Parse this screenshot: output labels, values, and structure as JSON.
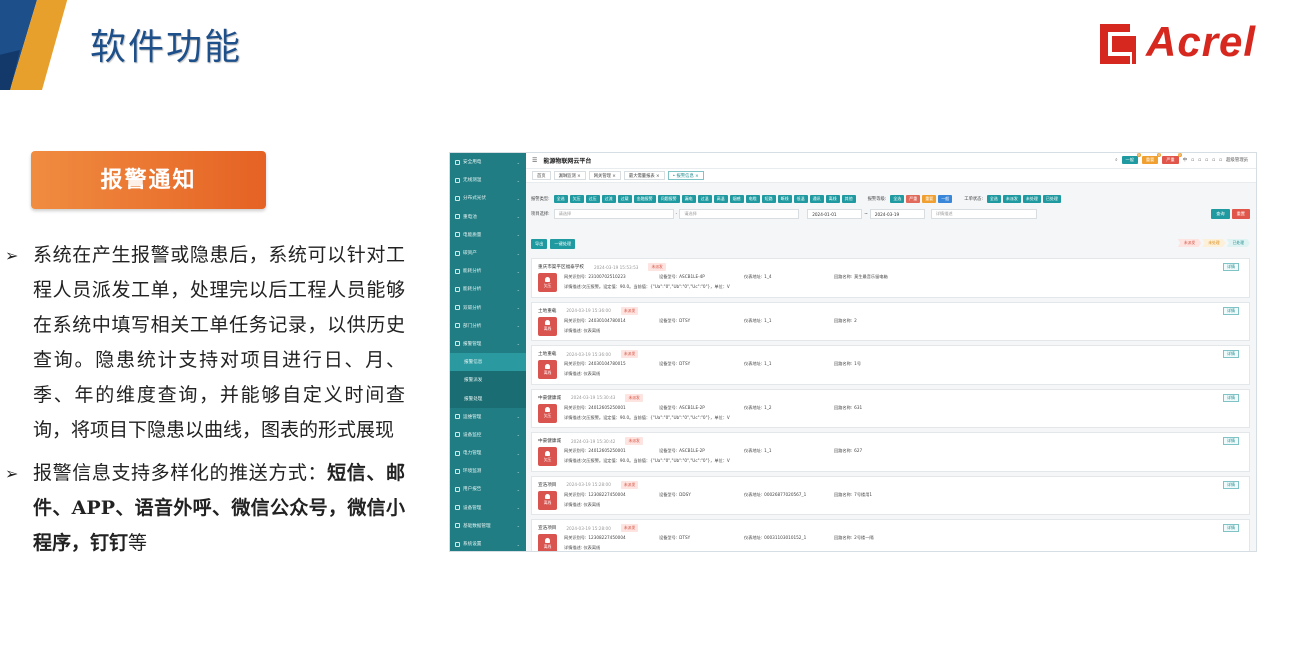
{
  "slide": {
    "title": "软件功能",
    "logo_text": "Acrel",
    "section_badge": "报警通知",
    "bullets": [
      {
        "text": "系统在产生报警或隐患后，系统可以针对工程人员派发工单，处理完以后工程人员能够在系统中填写相关工单任务记录，以供历史查询。隐患统计支持对项目进行日、月、季、年的维度查询，并能够自定义时间查询，将项目下隐患以曲线，图表的形式展现"
      },
      {
        "text_plain": "报警信息支持多样化的推送方式：",
        "text_bold": "短信、邮件、APP、语音外呼、微信公众号，微信小程序，钉钉",
        "text_tail": "等"
      }
    ],
    "colors": {
      "title": "#1d4f8a",
      "badge": "#e8702d",
      "logo": "#d7281f",
      "sidebar": "#1f7d83"
    }
  },
  "app": {
    "title": "能源物联网云平台",
    "top_right": {
      "badges": [
        {
          "label": "一般",
          "count": "0",
          "color": "#1f9aa0"
        },
        {
          "label": "重要",
          "count": "0",
          "color": "#f0a030"
        },
        {
          "label": "严重",
          "count": "0",
          "color": "#e0564a"
        }
      ],
      "lang": "中",
      "user": "超级管理员"
    },
    "sidebar": [
      {
        "label": "安全用电"
      },
      {
        "label": "无线测温"
      },
      {
        "label": "分布式光伏"
      },
      {
        "label": "重电池"
      },
      {
        "label": "电能质量"
      },
      {
        "label": "碳资产"
      },
      {
        "label": "能耗分析"
      },
      {
        "label": "能耗分析"
      },
      {
        "label": "双碳分析"
      },
      {
        "label": "部门分析"
      },
      {
        "label": "报警管理"
      },
      {
        "label": "报警信息",
        "sub": true,
        "active": true
      },
      {
        "label": "报警派发",
        "sub": true
      },
      {
        "label": "报警处理",
        "sub": true
      },
      {
        "label": "运维管理"
      },
      {
        "label": "设备监控"
      },
      {
        "label": "电力管理"
      },
      {
        "label": "环境监测"
      },
      {
        "label": "用户报告"
      },
      {
        "label": "设备管理"
      },
      {
        "label": "基础数据管理"
      },
      {
        "label": "系统设置"
      }
    ],
    "tabs": [
      {
        "label": "首页"
      },
      {
        "label": "漏琳监测 ×"
      },
      {
        "label": "网关管理 ×"
      },
      {
        "label": "最大需量报表 ×"
      },
      {
        "label": "• 报警信息 ×",
        "active": true
      }
    ],
    "filters": {
      "type_label": "报警类型:",
      "types": [
        "全选",
        "欠压",
        "过压",
        "过流",
        "过载",
        "金融报警",
        "问题报警",
        "漏电",
        "过温",
        "高温",
        "烟感",
        "电缆",
        "短路",
        "断线",
        "低温",
        "通讯",
        "离线",
        "其他"
      ],
      "level_label": "报警等级:",
      "levels": [
        {
          "label": "全选",
          "c": ""
        },
        {
          "label": "严重",
          "c": "red"
        },
        {
          "label": "重要",
          "c": "orange"
        },
        {
          "label": "一般",
          "c": "blue"
        }
      ],
      "status_label": "工单状态:",
      "statuses": [
        "全选",
        "未派发",
        "未处理",
        "已处理"
      ],
      "project_label": "项目选择:",
      "project_placeholder": "请选择",
      "select2_placeholder": "请选择",
      "date_from": "2024-01-01",
      "date_sep": "~",
      "date_to": "2024-03-19",
      "desc_placeholder": "详情描述",
      "query_label": "查询",
      "reset_label": "重置"
    },
    "actions": {
      "export": "导出",
      "batch": "一键处理"
    },
    "steps": [
      {
        "label": "未派发",
        "bg": "#fde4e1",
        "fg": "#d9503f"
      },
      {
        "label": "未处理",
        "bg": "#fdf0d9",
        "fg": "#d88a15"
      },
      {
        "label": "已处理",
        "bg": "#dff3f3",
        "fg": "#1f8a8f"
      }
    ],
    "cards": [
      {
        "site": "重庆市渠平区福泰学校",
        "time": "2024-03-19 15:53:53",
        "status": "未派发",
        "icon_label": "欠压",
        "gateway": "23100702510223",
        "model": "ASCB1LE-4P",
        "addr": "1_4",
        "loop": "莫生最音乐留电箱",
        "desc": "详情描述:欠压报警。设定值：90.0。当前值：{\"Ua\":\"0\",\"Ub\":\"0\",\"Uc\":\"0\"}，单位：V",
        "detail": "详情"
      },
      {
        "site": "土地重载",
        "time": "2024-03-19 15:36:00",
        "status": "未派发",
        "icon_label": "离线",
        "gateway": "24030104780014",
        "model": "DTSY",
        "addr": "1_1",
        "loop": "2",
        "desc": "详情描述: 仪表离线",
        "detail": "详情"
      },
      {
        "site": "土地重载",
        "time": "2024-03-19 15:36:00",
        "status": "未派发",
        "icon_label": "离线",
        "gateway": "24030104780015",
        "model": "DTSY",
        "addr": "1_1",
        "loop": "1号",
        "desc": "详情描述: 仪表离线",
        "detail": "详情"
      },
      {
        "site": "中豪健康城",
        "time": "2024-03-19 15:30:43",
        "status": "未派发",
        "icon_label": "欠压",
        "gateway": "24012605250001",
        "model": "ASCB1LE-2P",
        "addr": "1_2",
        "loop": "631",
        "desc": "详情描述:欠压报警。设定值：90.0。当前值：{\"Ua\":\"0\",\"Ub\":\"0\",\"Uc\":\"0\"}，单位：V",
        "detail": "详情"
      },
      {
        "site": "中豪健康城",
        "time": "2024-03-19 15:30:42",
        "status": "未派发",
        "icon_label": "欠压",
        "gateway": "24012605250001",
        "model": "ASCB1LE-2P",
        "addr": "1_1",
        "loop": "627",
        "desc": "详情描述:欠压报警。设定值：90.0。当前值：{\"Ua\":\"0\",\"Ub\":\"0\",\"Uc\":\"0\"}，单位：V",
        "detail": "详情"
      },
      {
        "site": "宣浩项目",
        "time": "2024-03-19 15:28:00",
        "status": "未派发",
        "icon_label": "离线",
        "gateway": "12308227450004",
        "model": "DDSY",
        "addr": "00026877020567_1",
        "loop": "7号楼用1",
        "desc": "详情描述: 仪表离线",
        "detail": "详情"
      },
      {
        "site": "宣浩项目",
        "time": "2024-03-19 15:28:00",
        "status": "未派发",
        "icon_label": "离线",
        "gateway": "12308227450004",
        "model": "DTSY",
        "addr": "00031103010152_1",
        "loop": "2号楼一隔",
        "desc": "详情描述: 仪表离线",
        "detail": "详情"
      }
    ],
    "card_labels": {
      "gateway": "网关识别号:",
      "model": "设备型号:",
      "addr": "仪表地址:",
      "loop": "回路名称:"
    }
  }
}
